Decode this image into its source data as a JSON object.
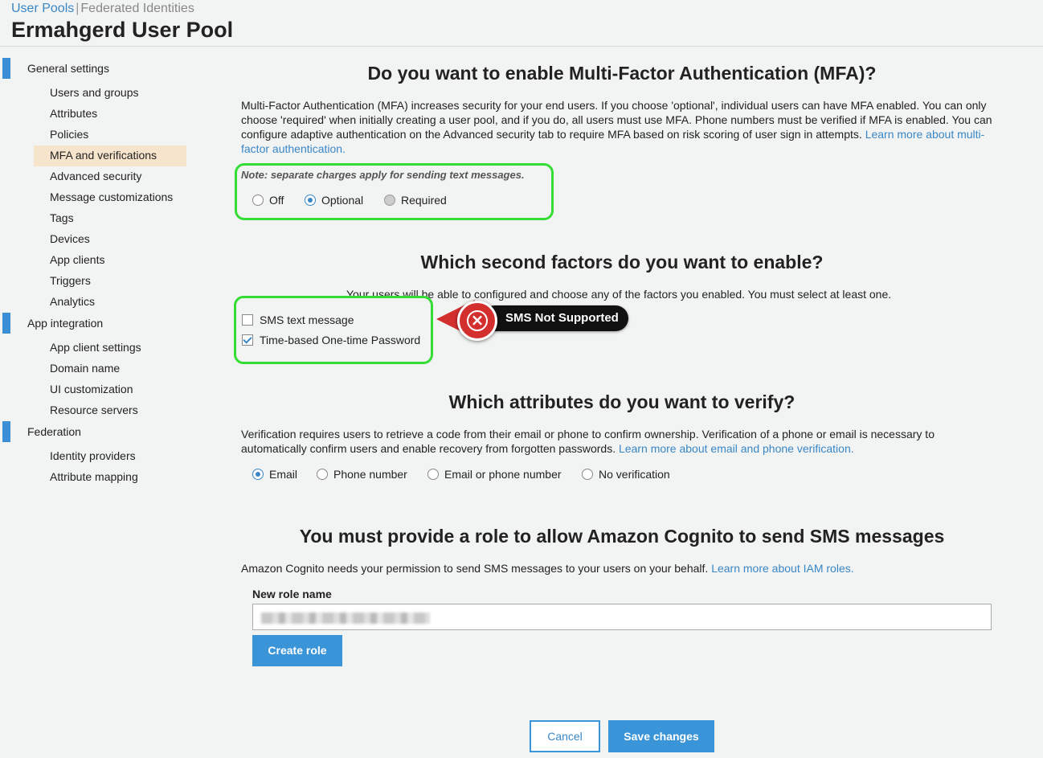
{
  "breadcrumb": {
    "active": "User Pools",
    "separator": "|",
    "other": "Federated Identities"
  },
  "pool_title": "Ermahgerd User Pool",
  "sidebar": {
    "sections": [
      {
        "label": "General settings",
        "items": [
          "Users and groups",
          "Attributes",
          "Policies",
          "MFA and verifications",
          "Advanced security",
          "Message customizations",
          "Tags",
          "Devices",
          "App clients",
          "Triggers",
          "Analytics"
        ]
      },
      {
        "label": "App integration",
        "items": [
          "App client settings",
          "Domain name",
          "UI customization",
          "Resource servers"
        ]
      },
      {
        "label": "Federation",
        "items": [
          "Identity providers",
          "Attribute mapping"
        ]
      }
    ],
    "active_item": "MFA and verifications",
    "accent_color": "#3a8fd6"
  },
  "mfa": {
    "heading": "Do you want to enable Multi-Factor Authentication (MFA)?",
    "description": "Multi-Factor Authentication (MFA) increases security for your end users. If you choose 'optional', individual users can have MFA enabled. You can only choose 'required' when initially creating a user pool, and if you do, all users must use MFA. Phone numbers must be verified if MFA is enabled. You can configure adaptive authentication on the Advanced security tab to require MFA based on risk scoring of user sign in attempts.",
    "link": "Learn more about multi-factor authentication.",
    "note": "Note: separate charges apply for sending text messages.",
    "options": [
      "Off",
      "Optional",
      "Required"
    ],
    "selected": "Optional"
  },
  "second_factors": {
    "heading": "Which second factors do you want to enable?",
    "description": "Your users will be able to configured and choose any of the factors you enabled. You must select at least one.",
    "options": [
      {
        "label": "SMS text message",
        "checked": false
      },
      {
        "label": "Time-based One-time Password",
        "checked": true
      }
    ],
    "callout": {
      "label": "SMS Not Supported",
      "icon": "x-circle-icon",
      "color": "#d32f2f"
    }
  },
  "verify": {
    "heading": "Which attributes do you want to verify?",
    "description": "Verification requires users to retrieve a code from their email or phone to confirm ownership. Verification of a phone or email is necessary to automatically confirm users and enable recovery from forgotten passwords.",
    "link": "Learn more about email and phone verification.",
    "options": [
      "Email",
      "Phone number",
      "Email or phone number",
      "No verification"
    ],
    "selected": "Email"
  },
  "role": {
    "heading": "You must provide a role to allow Amazon Cognito to send SMS messages",
    "description": "Amazon Cognito needs your permission to send SMS messages to your users on your behalf.",
    "link": "Learn more about IAM roles.",
    "field_label": "New role name",
    "create_button": "Create role"
  },
  "footer": {
    "cancel": "Cancel",
    "save": "Save changes"
  }
}
